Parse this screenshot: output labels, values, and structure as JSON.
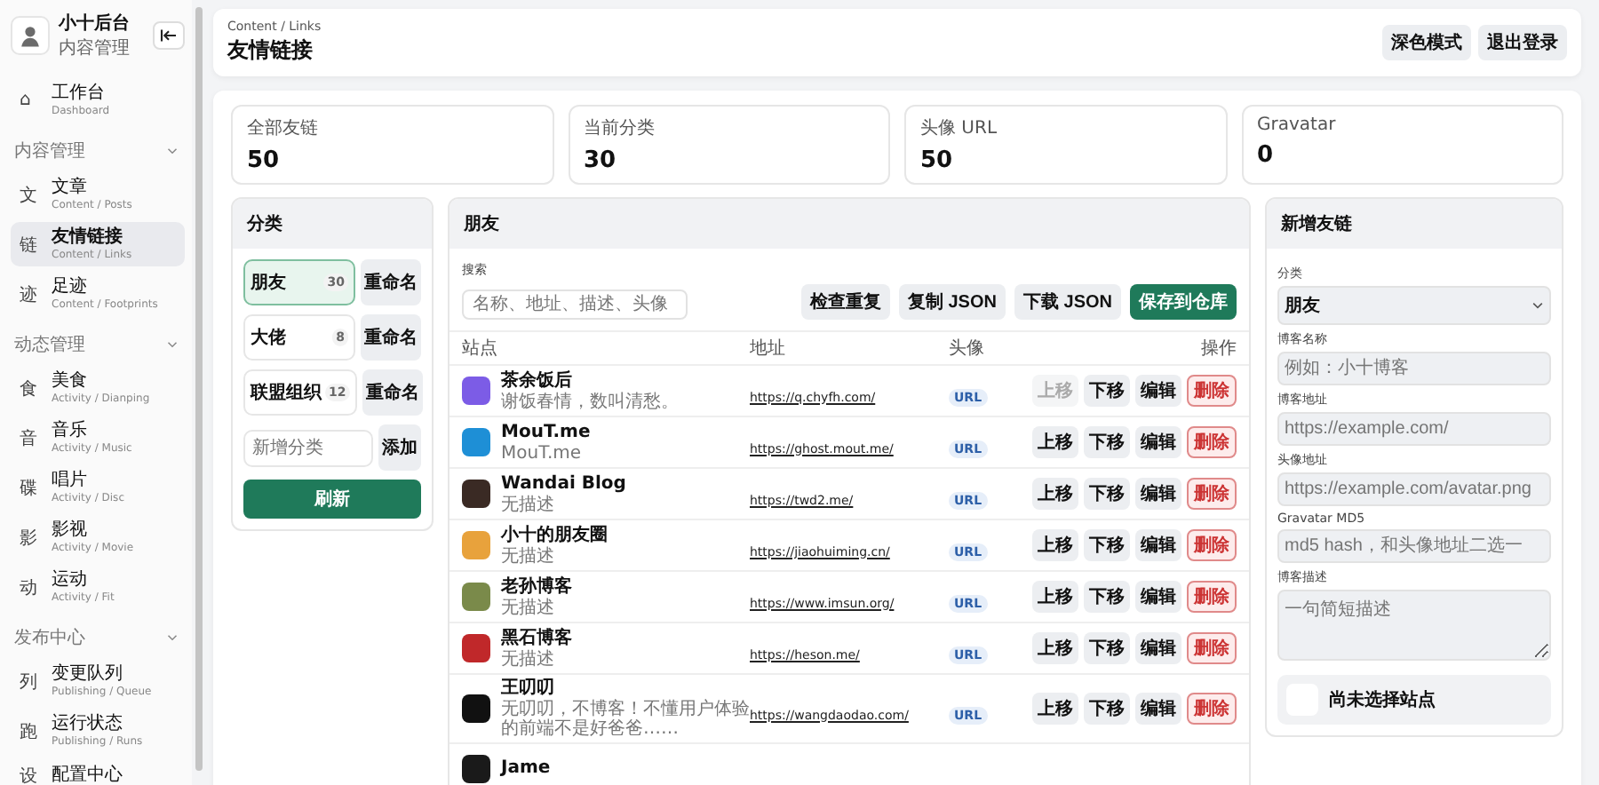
{
  "sidebar": {
    "brand": {
      "title": "小十后台",
      "subtitle": "内容管理"
    },
    "top_items": [
      {
        "icon": "⌂",
        "title": "工作台",
        "subtitle": "Dashboard",
        "selected": false
      }
    ],
    "sections": [
      {
        "title": "内容管理",
        "expanded": true,
        "items": [
          {
            "icon": "文",
            "title": "文章",
            "subtitle": "Content / Posts",
            "selected": false
          },
          {
            "icon": "链",
            "title": "友情链接",
            "subtitle": "Content / Links",
            "selected": true
          },
          {
            "icon": "迹",
            "title": "足迹",
            "subtitle": "Content / Footprints",
            "selected": false
          }
        ]
      },
      {
        "title": "动态管理",
        "expanded": true,
        "items": [
          {
            "icon": "食",
            "title": "美食",
            "subtitle": "Activity / Dianping",
            "selected": false
          },
          {
            "icon": "音",
            "title": "音乐",
            "subtitle": "Activity / Music",
            "selected": false
          },
          {
            "icon": "碟",
            "title": "唱片",
            "subtitle": "Activity / Disc",
            "selected": false
          },
          {
            "icon": "影",
            "title": "影视",
            "subtitle": "Activity / Movie",
            "selected": false
          },
          {
            "icon": "动",
            "title": "运动",
            "subtitle": "Activity / Fit",
            "selected": false
          }
        ]
      },
      {
        "title": "发布中心",
        "expanded": true,
        "items": [
          {
            "icon": "列",
            "title": "变更队列",
            "subtitle": "Publishing / Queue",
            "selected": false
          },
          {
            "icon": "跑",
            "title": "运行状态",
            "subtitle": "Publishing / Runs",
            "selected": false
          },
          {
            "icon": "设",
            "title": "配置中心",
            "selected": false
          }
        ]
      }
    ]
  },
  "header": {
    "breadcrumb": "Content / Links",
    "title": "友情链接",
    "buttons": [
      "深色模式",
      "退出登录"
    ]
  },
  "stats": [
    {
      "label": "全部友链",
      "value": "50"
    },
    {
      "label": "当前分类",
      "value": "30"
    },
    {
      "label": "头像 URL",
      "value": "50"
    },
    {
      "label": "Gravatar",
      "value": "0"
    }
  ],
  "categories": {
    "title": "分类",
    "items": [
      {
        "name": "朋友",
        "count": "30",
        "selected": true,
        "rename": "重命名"
      },
      {
        "name": "大佬",
        "count": "8",
        "selected": false,
        "rename": "重命名"
      },
      {
        "name": "联盟组织",
        "count": "12",
        "selected": false,
        "rename": "重命名"
      }
    ],
    "new_placeholder": "新增分类",
    "add_button": "添加",
    "refresh_button": "刷新"
  },
  "friends": {
    "title": "朋友",
    "search_label": "搜索",
    "search_placeholder": "名称、地址、描述、头像",
    "toolbar": [
      {
        "label": "检查重复",
        "kind": "plain"
      },
      {
        "label": "复制 JSON",
        "kind": "plain"
      },
      {
        "label": "下载 JSON",
        "kind": "plain"
      },
      {
        "label": "保存到仓库",
        "kind": "primary"
      }
    ],
    "columns": [
      "站点",
      "地址",
      "头像",
      "操作"
    ],
    "rows": [
      {
        "name": "茶余饭后",
        "desc": "谢饭春情，数叫清愁。",
        "url": "https://q.chyfh.com/",
        "avatar": "URL",
        "color": "#7c5ce6",
        "actions": [
          {
            "label": "上移",
            "disabled": true
          },
          {
            "label": "下移",
            "disabled": false
          },
          {
            "label": "编辑",
            "disabled": false
          },
          {
            "label": "删除",
            "disabled": false
          }
        ]
      },
      {
        "name": "MouT.me",
        "desc": "MouT.me",
        "url": "https://ghost.mout.me/",
        "avatar": "URL",
        "color": "#1e8fd6",
        "actions": [
          {
            "label": "上移",
            "disabled": false
          },
          {
            "label": "下移",
            "disabled": false
          },
          {
            "label": "编辑",
            "disabled": false
          },
          {
            "label": "删除",
            "disabled": false
          }
        ]
      },
      {
        "name": "Wandai Blog",
        "desc": "无描述",
        "url": "https://twd2.me/",
        "avatar": "URL",
        "color": "#3a2a24",
        "actions": [
          {
            "label": "上移",
            "disabled": false
          },
          {
            "label": "下移",
            "disabled": false
          },
          {
            "label": "编辑",
            "disabled": false
          },
          {
            "label": "删除",
            "disabled": false
          }
        ]
      },
      {
        "name": "小十的朋友圈",
        "desc": "无描述",
        "url": "https://jiaohuiming.cn/",
        "avatar": "URL",
        "color": "#e8a23c",
        "actions": [
          {
            "label": "上移",
            "disabled": false
          },
          {
            "label": "下移",
            "disabled": false
          },
          {
            "label": "编辑",
            "disabled": false
          },
          {
            "label": "删除",
            "disabled": false
          }
        ]
      },
      {
        "name": "老孙博客",
        "desc": "无描述",
        "url": "https://www.imsun.org/",
        "avatar": "URL",
        "color": "#7a8a4a",
        "actions": [
          {
            "label": "上移",
            "disabled": false
          },
          {
            "label": "下移",
            "disabled": false
          },
          {
            "label": "编辑",
            "disabled": false
          },
          {
            "label": "删除",
            "disabled": false
          }
        ]
      },
      {
        "name": "黑石博客",
        "desc": "无描述",
        "url": "https://heson.me/",
        "avatar": "URL",
        "color": "#c0282a",
        "actions": [
          {
            "label": "上移",
            "disabled": false
          },
          {
            "label": "下移",
            "disabled": false
          },
          {
            "label": "编辑",
            "disabled": false
          },
          {
            "label": "删除",
            "disabled": false
          }
        ]
      },
      {
        "name": "王叨叨",
        "desc": "无叨叨，不博客！不懂用户体验的前端不是好爸爸……",
        "url": "https://wangdaodao.com/",
        "avatar": "URL",
        "color": "#111111",
        "actions": [
          {
            "label": "上移",
            "disabled": false
          },
          {
            "label": "下移",
            "disabled": false
          },
          {
            "label": "编辑",
            "disabled": false
          },
          {
            "label": "删除",
            "disabled": false
          }
        ]
      },
      {
        "name": "Jame",
        "color": "#1a1a1a"
      }
    ]
  },
  "form": {
    "title": "新增友链",
    "fields": [
      {
        "label": "分类",
        "kind": "select",
        "value": "朋友"
      },
      {
        "label": "博客名称",
        "kind": "input",
        "placeholder": "例如：小十博客"
      },
      {
        "label": "博客地址",
        "kind": "input",
        "placeholder": "https://example.com/"
      },
      {
        "label": "头像地址",
        "kind": "input",
        "placeholder": "https://example.com/avatar.png"
      },
      {
        "label": "Gravatar MD5",
        "kind": "input",
        "placeholder": "md5 hash，和头像地址二选一"
      },
      {
        "label": "博客描述",
        "kind": "textarea",
        "placeholder": "一句简短描述"
      }
    ],
    "preview_title": "尚未选择站点"
  }
}
